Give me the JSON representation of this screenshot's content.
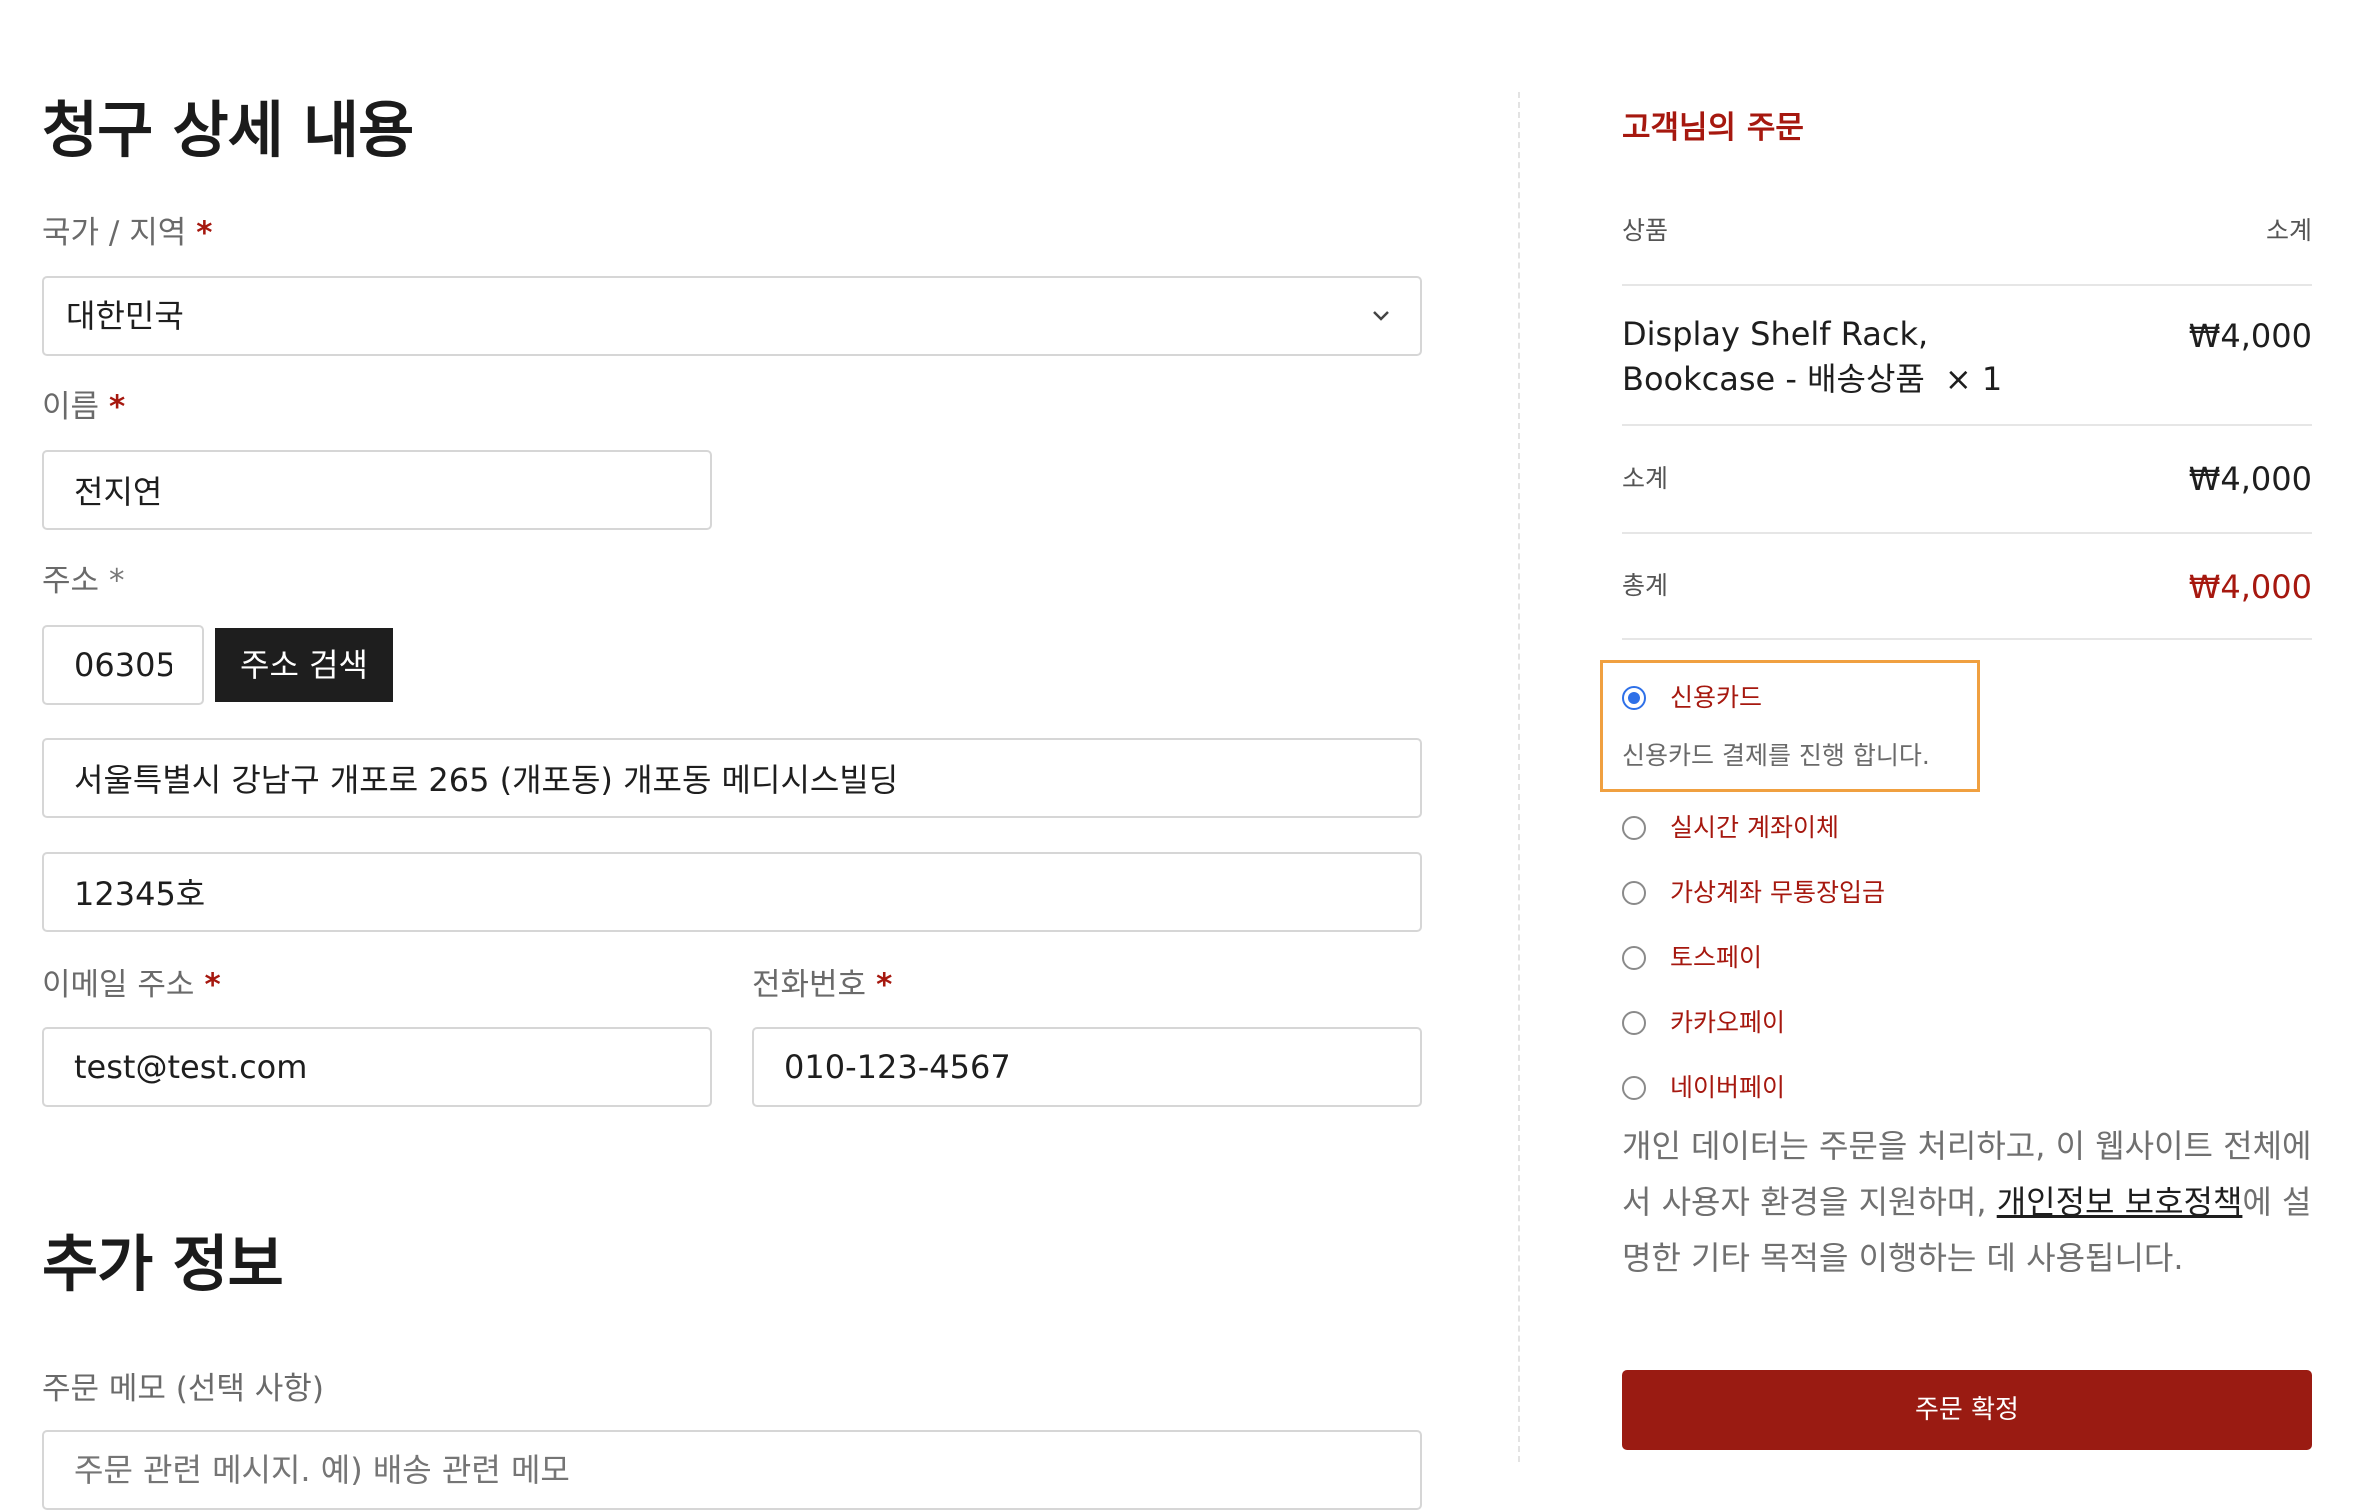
{
  "billing": {
    "title": "청구 상세 내용",
    "country_label": "국가 / 지역",
    "required_mark": "*",
    "country_value": "대한민국",
    "name_label": "이름",
    "name_value": "전지연",
    "address_label": "주소",
    "postcode_value": "06305",
    "address_search_button": "주소 검색",
    "address_line1": "서울특별시 강남구 개포로 265 (개포동) 개포동 메디시스빌딩",
    "address_line2": "12345호",
    "email_label": "이메일 주소",
    "email_value": "test@test.com",
    "phone_label": "전화번호",
    "phone_value": "010-123-4567"
  },
  "additional": {
    "title": "추가 정보",
    "memo_label": "주문 메모 (선택 사항)",
    "memo_placeholder": "주문 관련 메시지. 예) 배송 관련 메모"
  },
  "order": {
    "title": "고객님의 주문",
    "col_product": "상품",
    "col_subtotal": "소계",
    "item_name_line1": "Display Shelf Rack,",
    "item_name_line2": "Bookcase - 배송상품",
    "item_qty": "× 1",
    "item_price": "₩4,000",
    "subtotal_label": "소계",
    "subtotal_value": "₩4,000",
    "total_label": "총계",
    "total_value": "₩4,000",
    "payment_methods": [
      {
        "label": "신용카드",
        "selected": true,
        "description": "신용카드 결제를 진행 합니다."
      },
      {
        "label": "실시간 계좌이체",
        "selected": false
      },
      {
        "label": "가상계좌 무통장입금",
        "selected": false
      },
      {
        "label": "토스페이",
        "selected": false
      },
      {
        "label": "카카오페이",
        "selected": false
      },
      {
        "label": "네이버페이",
        "selected": false
      }
    ],
    "privacy_text_before": "개인 데이터는 주문을 처리하고, 이 웹사이트 전체에서 사용자 환경을 지원하며, ",
    "privacy_link": "개인정보 보호정책",
    "privacy_text_after": "에 설명한 기타 목적을 이행하는 데 사용됩니다.",
    "place_order_button": "주문 확정"
  },
  "colors": {
    "accent": "#9a1b12",
    "selected_radio": "#2e70e8",
    "highlight_border": "#f0a040"
  }
}
